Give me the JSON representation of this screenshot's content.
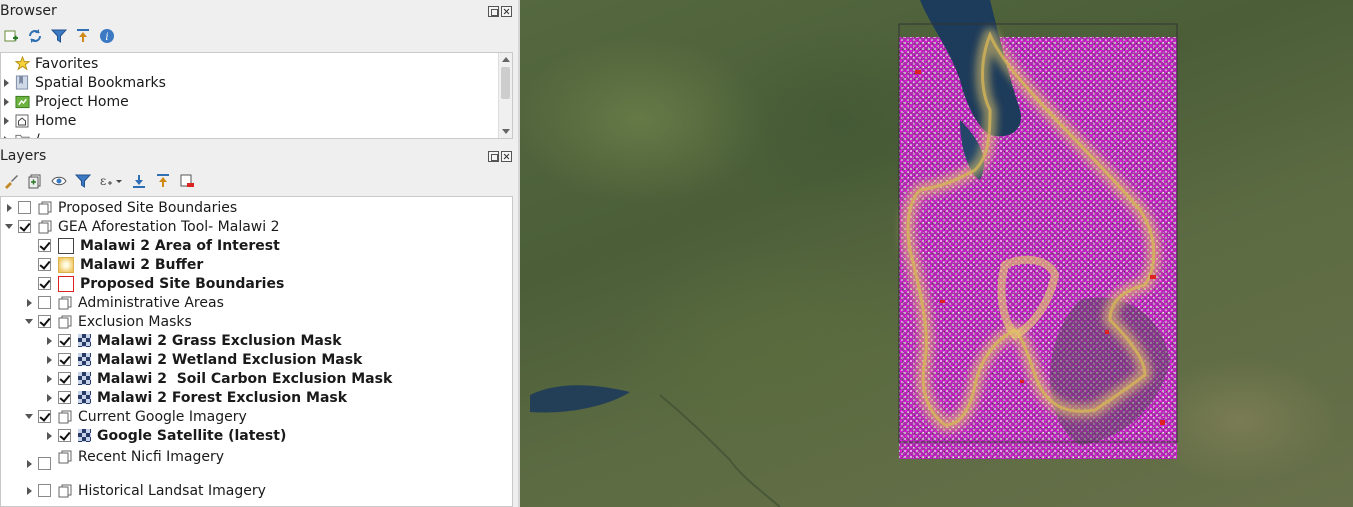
{
  "browser_panel": {
    "title": "Browser",
    "toolbar_icons": [
      "add-layer-icon",
      "refresh-icon",
      "filter-icon",
      "collapse-all-icon",
      "info-icon"
    ],
    "items": [
      {
        "label": "Favorites",
        "icon": "star-icon"
      },
      {
        "label": "Spatial Bookmarks",
        "icon": "bookmark-icon"
      },
      {
        "label": "Project Home",
        "icon": "project-home-icon"
      },
      {
        "label": "Home",
        "icon": "home-icon"
      },
      {
        "label": "/",
        "icon": "folder-icon"
      }
    ]
  },
  "layers_panel": {
    "title": "Layers",
    "toolbar_icons": [
      "style-icon",
      "add-group-icon",
      "visibility-icon",
      "filter-icon",
      "expression-filter-icon",
      "expand-all-icon",
      "collapse-all-icon",
      "remove-layer-icon"
    ],
    "items": [
      {
        "label": "Proposed Site Boundaries",
        "checked": false,
        "level": 0,
        "arrow": "right",
        "type": "group",
        "bold": false
      },
      {
        "label": "GEA Aforestation Tool- Malawi 2",
        "checked": true,
        "level": 0,
        "arrow": "down",
        "type": "group",
        "bold": false
      },
      {
        "label": "Malawi 2 Area of Interest",
        "checked": true,
        "level": 1,
        "arrow": "none",
        "type": "polygon-empty",
        "bold": true
      },
      {
        "label": "Malawi 2 Buffer",
        "checked": true,
        "level": 1,
        "arrow": "none",
        "type": "polygon-buffer",
        "bold": true
      },
      {
        "label": "Proposed Site Boundaries",
        "checked": true,
        "level": 1,
        "arrow": "none",
        "type": "polygon-red",
        "bold": true
      },
      {
        "label": "Administrative Areas",
        "checked": false,
        "level": 1,
        "arrow": "right",
        "type": "group",
        "bold": false
      },
      {
        "label": "Exclusion Masks",
        "checked": true,
        "level": 1,
        "arrow": "down",
        "type": "group",
        "bold": false
      },
      {
        "label": "Malawi 2 Grass Exclusion Mask",
        "checked": true,
        "level": 2,
        "arrow": "right",
        "type": "raster",
        "bold": true
      },
      {
        "label": "Malawi 2 Wetland Exclusion Mask",
        "checked": true,
        "level": 2,
        "arrow": "right",
        "type": "raster",
        "bold": true
      },
      {
        "label": "Malawi 2  Soil Carbon Exclusion Mask",
        "checked": true,
        "level": 2,
        "arrow": "right",
        "type": "raster",
        "bold": true
      },
      {
        "label": "Malawi 2 Forest Exclusion Mask",
        "checked": true,
        "level": 2,
        "arrow": "right",
        "type": "raster",
        "bold": true
      },
      {
        "label": "Current Google Imagery",
        "checked": true,
        "level": 1,
        "arrow": "down",
        "type": "group",
        "bold": false
      },
      {
        "label": "Google Satellite (latest)",
        "checked": true,
        "level": 2,
        "arrow": "right",
        "type": "raster",
        "bold": true
      },
      {
        "label": "Recent Nicfi Imagery",
        "checked": false,
        "level": 1,
        "arrow": "right",
        "type": "group",
        "bold": false
      },
      {
        "label": "Historical Landsat Imagery",
        "checked": false,
        "level": 1,
        "arrow": "right",
        "type": "group",
        "bold": false
      }
    ]
  },
  "colors": {
    "mask_magenta": "#e619e6",
    "buffer_yellow": "#e7c96a",
    "lake_blue": "#1d3b5a",
    "boundary_red": "#d22"
  }
}
